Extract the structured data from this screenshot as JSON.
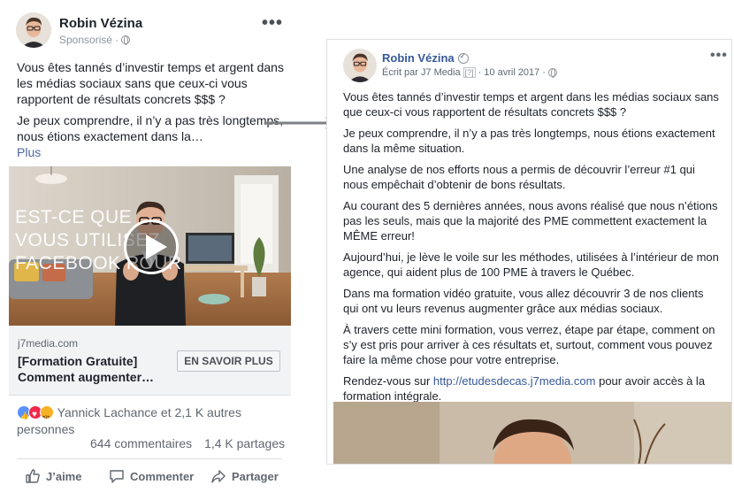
{
  "left_post": {
    "author": "Robin Vézina",
    "sponsored_label": "Sponsorisé",
    "meta_separator": "·",
    "more_label": "•••",
    "paragraph_1": "Vous êtes tannés d’investir temps et argent dans les médias sociaux sans que ceux-ci vous rapportent de résultats concrets $$$ ?",
    "paragraph_2": "Je peux comprendre, il n’y a pas très longtemps, nous étions exactement dans la…",
    "see_more": "Plus",
    "video_overlay": "EST-CE QUE VOUS UTILISEZ FACEBOOK POUR",
    "domain": "j7media.com",
    "headline": "[Formation Gratuite] Comment augmenter…",
    "cta_button": "EN SAVOIR PLUS",
    "reactions_text": "Yannick Lachance et 2,1 K autres personnes",
    "comments": "644 commentaires",
    "shares": "1,4 K partages",
    "actions": {
      "like": "J’aime",
      "comment": "Commenter",
      "share": "Partager"
    }
  },
  "right_post": {
    "author": "Robin Vézina",
    "written_by_prefix": "Écrit par",
    "written_by": "J7 Media",
    "help_badge": "[?]",
    "meta_separator": "·",
    "date": "10 avril 2017",
    "more_label": "•••",
    "paragraphs": [
      "Vous êtes tannés d’investir temps et argent dans les médias sociaux sans que ceux-ci vous rapportent de résultats concrets $$$ ?",
      "Je peux comprendre, il n’y a pas très longtemps, nous étions exactement dans la même situation.",
      "Une analyse de nos efforts nous a permis de découvrir l’erreur #1 qui nous empêchait d’obtenir de bons résultats.",
      "Au courant des 5 dernières années, nous avons réalisé que nous n’étions pas les seuls, mais que la majorité des PME commettent exactement la MÊME erreur!",
      "Aujourd’hui, je lève le voile sur les méthodes, utilisées à l’intérieur de mon agence, qui aident plus de 100 PME à travers le Québec.",
      "Dans ma formation vidéo gratuite, vous allez découvrir 3 de nos clients qui ont vu leurs revenus augmenter grâce aux médias sociaux.",
      "À travers cette mini formation, vous verrez, étape par étape, comment on s’y est pris pour arriver à ces résultats et, surtout, comment vous pouvez faire la même chose pour votre entreprise."
    ],
    "last_paragraph_prefix": "Rendez-vous sur",
    "last_paragraph_link": "http://etudesdecas.j7media.com",
    "last_paragraph_suffix": "pour avoir accès à la formation intégrale."
  },
  "colors": {
    "fb_blue": "#365899",
    "text": "#1d2129",
    "muted": "#90949c",
    "arrow": "#7f8285"
  }
}
